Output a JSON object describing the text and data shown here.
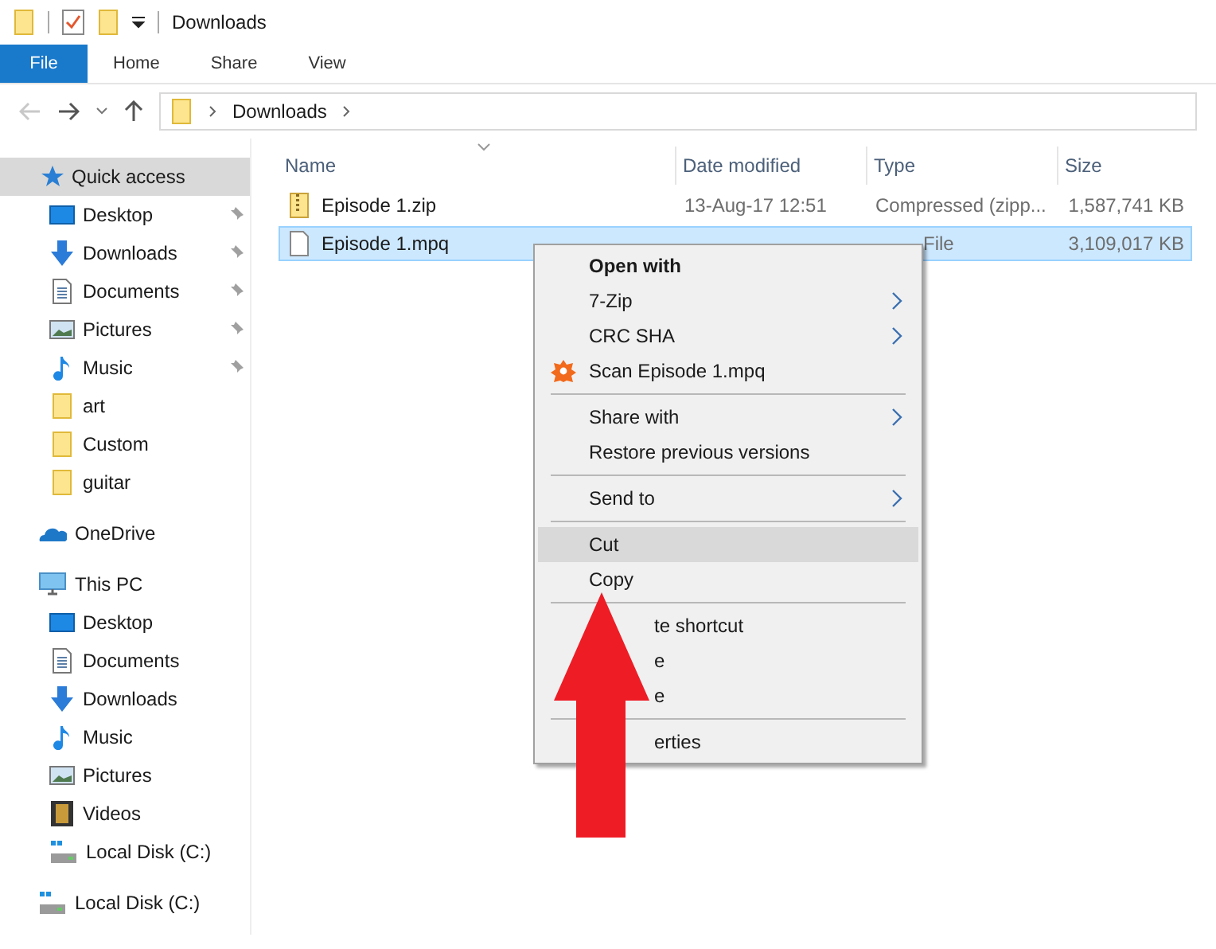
{
  "window": {
    "title": "Downloads"
  },
  "ribbon_tabs": [
    {
      "label": "File",
      "selected": true
    },
    {
      "label": "Home",
      "selected": false
    },
    {
      "label": "Share",
      "selected": false
    },
    {
      "label": "View",
      "selected": false
    }
  ],
  "address_bar": {
    "path": "Downloads"
  },
  "sidebar": {
    "items": [
      {
        "label": "Quick access",
        "kind": "star",
        "selected": true,
        "children": [
          {
            "label": "Desktop",
            "kind": "desktop",
            "pinned": true
          },
          {
            "label": "Downloads",
            "kind": "downloads",
            "pinned": true
          },
          {
            "label": "Documents",
            "kind": "documents",
            "pinned": true
          },
          {
            "label": "Pictures",
            "kind": "pictures",
            "pinned": true
          },
          {
            "label": "Music",
            "kind": "music",
            "pinned": true
          },
          {
            "label": "art",
            "kind": "folder",
            "pinned": false
          },
          {
            "label": "Custom",
            "kind": "folder",
            "pinned": false
          },
          {
            "label": "guitar",
            "kind": "folder",
            "pinned": false
          }
        ]
      },
      {
        "label": "OneDrive",
        "kind": "cloud",
        "selected": false
      },
      {
        "label": "This PC",
        "kind": "pc",
        "selected": false,
        "children": [
          {
            "label": "Desktop",
            "kind": "desktop",
            "pinned": false
          },
          {
            "label": "Documents",
            "kind": "documents",
            "pinned": false
          },
          {
            "label": "Downloads",
            "kind": "downloads",
            "pinned": false
          },
          {
            "label": "Music",
            "kind": "music",
            "pinned": false
          },
          {
            "label": "Pictures",
            "kind": "pictures",
            "pinned": false
          },
          {
            "label": "Videos",
            "kind": "videos",
            "pinned": false
          },
          {
            "label": "Local Disk (C:)",
            "kind": "disk",
            "pinned": false
          }
        ]
      },
      {
        "label": "Local Disk (C:)",
        "kind": "disk",
        "selected": false
      }
    ]
  },
  "table": {
    "columns": [
      "Name",
      "Date modified",
      "Type",
      "Size"
    ],
    "rows": [
      {
        "name": "Episode 1.zip",
        "kind": "zip",
        "date": "13-Aug-17 12:51",
        "type": "Compressed (zipp...",
        "size": "1,587,741 KB",
        "selected": false,
        "covered": false
      },
      {
        "name": "Episode 1.mpq",
        "kind": "file",
        "type": "File",
        "size": "3,109,017 KB",
        "selected": true,
        "covered": true
      }
    ]
  },
  "context_menu": {
    "items": [
      {
        "kind": "header",
        "label": "Open with"
      },
      {
        "kind": "item",
        "label": "7-Zip",
        "submenu": true,
        "highlighted": false,
        "partly_hidden": false
      },
      {
        "kind": "item",
        "label": "CRC SHA",
        "submenu": true,
        "highlighted": false,
        "partly_hidden": false
      },
      {
        "kind": "scan",
        "label": "Scan Episode 1.mpq",
        "submenu": false,
        "highlighted": false,
        "partly_hidden": false
      },
      {
        "kind": "separator"
      },
      {
        "kind": "item",
        "label": "Share with",
        "submenu": true,
        "highlighted": false,
        "partly_hidden": false
      },
      {
        "kind": "item",
        "label": "Restore previous versions",
        "submenu": false,
        "highlighted": false,
        "partly_hidden": false
      },
      {
        "kind": "separator"
      },
      {
        "kind": "item",
        "label": "Send to",
        "submenu": true,
        "highlighted": false,
        "partly_hidden": false
      },
      {
        "kind": "separator"
      },
      {
        "kind": "item",
        "label": "Cut",
        "submenu": false,
        "highlighted": true,
        "partly_hidden": false
      },
      {
        "kind": "item",
        "label": "Copy",
        "submenu": false,
        "highlighted": false,
        "partly_hidden": false
      },
      {
        "kind": "separator"
      },
      {
        "kind": "item",
        "label": "te shortcut",
        "submenu": false,
        "highlighted": false,
        "partly_hidden": true
      },
      {
        "kind": "item",
        "label": "e",
        "submenu": false,
        "highlighted": false,
        "partly_hidden": true
      },
      {
        "kind": "item",
        "label": "e",
        "submenu": false,
        "highlighted": false,
        "partly_hidden": true
      },
      {
        "kind": "separator"
      },
      {
        "kind": "item",
        "label": "erties",
        "submenu": false,
        "highlighted": false,
        "partly_hidden": true
      }
    ]
  }
}
